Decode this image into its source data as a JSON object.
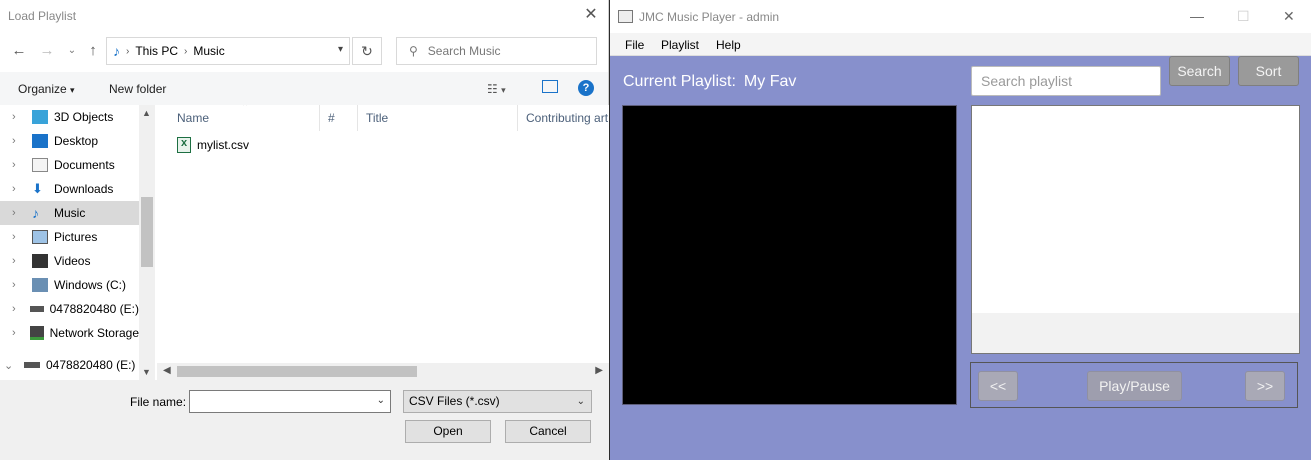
{
  "dialog": {
    "title": "Load Playlist",
    "address": {
      "root": "This PC",
      "folder": "Music"
    },
    "search_placeholder": "Search Music",
    "toolbar": {
      "organize": "Organize",
      "new_folder": "New folder"
    },
    "tree": [
      {
        "label": "3D Objects",
        "icon": "3d-objects-icon"
      },
      {
        "label": "Desktop",
        "icon": "desktop-icon"
      },
      {
        "label": "Documents",
        "icon": "documents-icon"
      },
      {
        "label": "Downloads",
        "icon": "downloads-icon"
      },
      {
        "label": "Music",
        "icon": "music-icon",
        "selected": true
      },
      {
        "label": "Pictures",
        "icon": "pictures-icon"
      },
      {
        "label": "Videos",
        "icon": "videos-icon"
      },
      {
        "label": "Windows (C:)",
        "icon": "drive-icon"
      },
      {
        "label": "0478820480 (E:)",
        "icon": "usb-drive-icon"
      },
      {
        "label": "Network Storage",
        "icon": "network-drive-icon"
      },
      {
        "label": "0478820480 (E:)",
        "icon": "usb-drive-icon"
      }
    ],
    "columns": [
      "Name",
      "#",
      "Title",
      "Contributing art"
    ],
    "files": [
      {
        "name": "mylist.csv",
        "icon": "excel-file-icon"
      }
    ],
    "file_name_label": "File name:",
    "file_name_value": "",
    "file_type": "CSV Files (*.csv)",
    "open_label": "Open",
    "cancel_label": "Cancel"
  },
  "player": {
    "title": "JMC Music Player - admin",
    "menu": [
      "File",
      "Playlist",
      "Help"
    ],
    "current_playlist_label": "Current Playlist:",
    "current_playlist_name": "My Fav",
    "search_placeholder": "Search playlist",
    "search_label": "Search",
    "sort_label": "Sort",
    "prev_label": "<<",
    "play_pause_label": "Play/Pause",
    "next_label": ">>",
    "colors": {
      "background": "#8790cc",
      "video": "#000000"
    }
  }
}
